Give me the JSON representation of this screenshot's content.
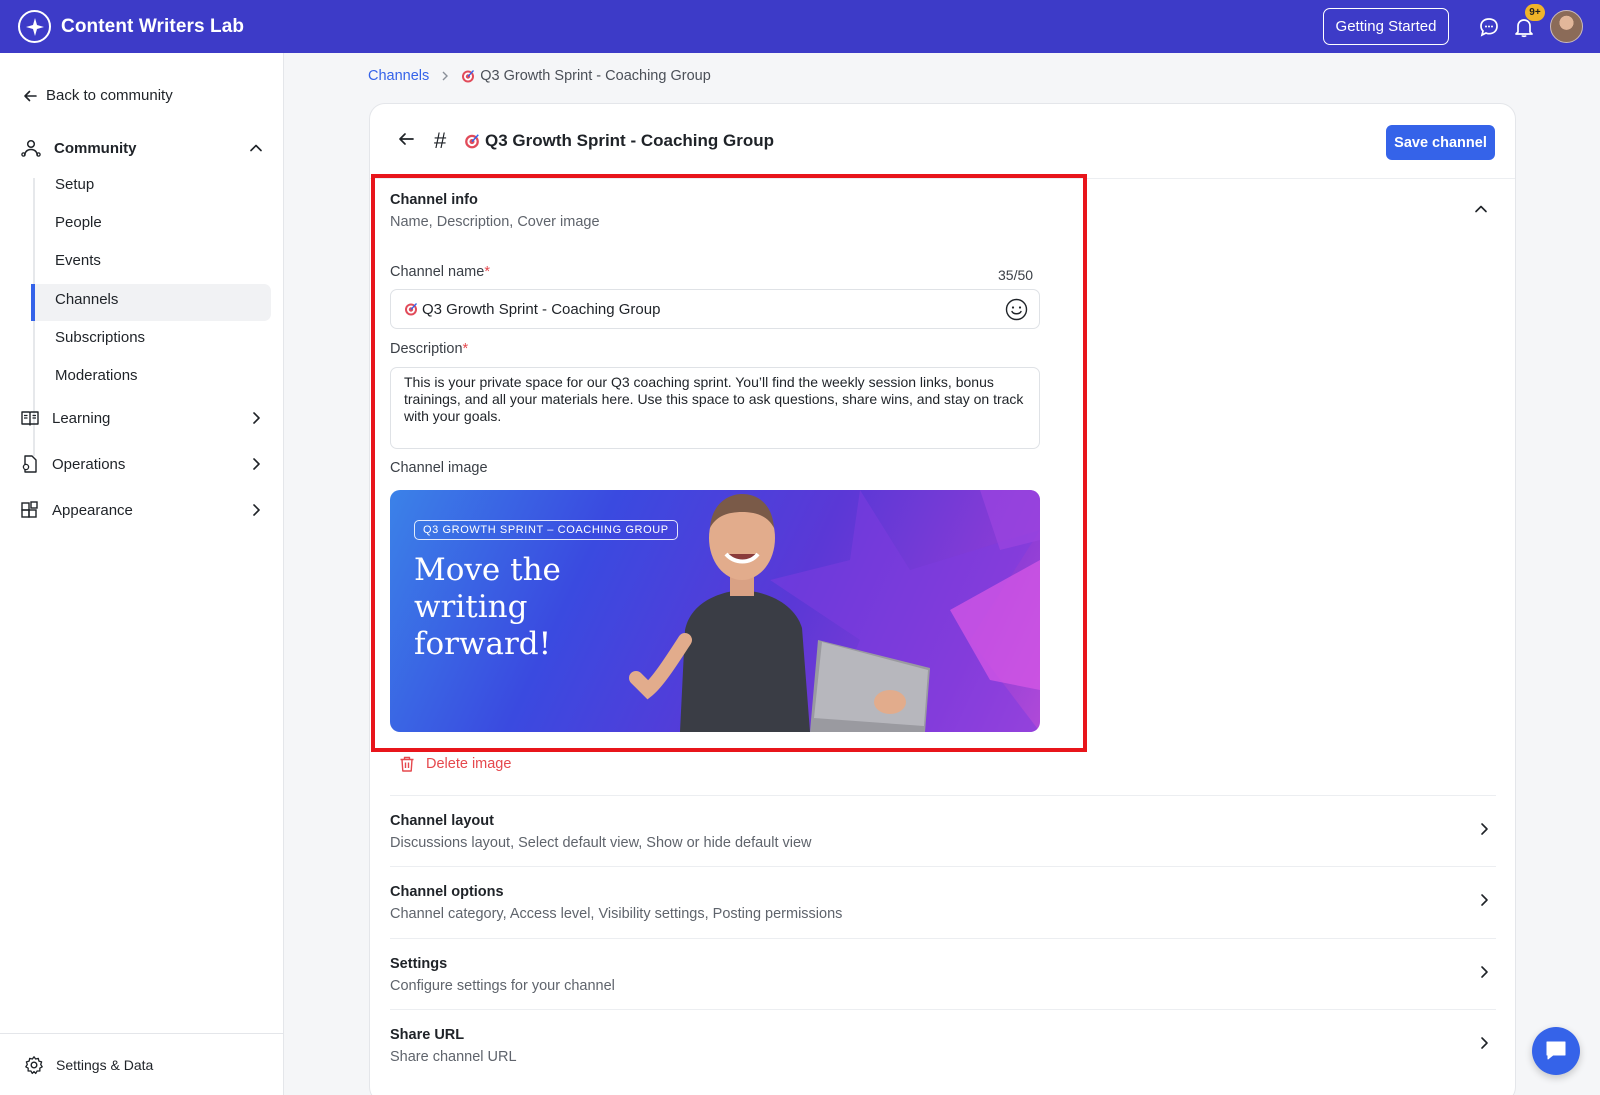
{
  "app": {
    "title": "Content Writers Lab"
  },
  "topbar": {
    "getting_started": "Getting Started",
    "notifications_badge": "9+"
  },
  "sidebar": {
    "back": "Back to community",
    "community": {
      "label": "Community",
      "items": [
        {
          "label": "Setup"
        },
        {
          "label": "People"
        },
        {
          "label": "Events"
        },
        {
          "label": "Channels",
          "active": true
        },
        {
          "label": "Subscriptions"
        },
        {
          "label": "Moderations"
        }
      ]
    },
    "learning": "Learning",
    "operations": "Operations",
    "appearance": "Appearance",
    "settings_data": "Settings & Data"
  },
  "breadcrumb": {
    "parent": "Channels",
    "current": "Q3 Growth Sprint - Coaching Group"
  },
  "channel": {
    "title": "Q3 Growth Sprint - Coaching Group",
    "save_label": "Save channel"
  },
  "channel_info": {
    "title": "Channel info",
    "subtitle": "Name, Description, Cover image",
    "name_label": "Channel name",
    "required_mark": "*",
    "counter": "35/50",
    "name_value": "Q3 Growth Sprint - Coaching Group",
    "description_label": "Description",
    "description_value": "This is your private space for our Q3 coaching sprint. You’ll find the weekly session links, bonus trainings, and all your materials here. Use this space to ask questions, share wins, and stay on track with your goals.",
    "image_label": "Channel image",
    "cover_tag": "Q3 GROWTH SPRINT – COACHING GROUP",
    "cover_headline": "Move the writing forward!",
    "delete_image": "Delete image"
  },
  "sections": [
    {
      "title": "Channel layout",
      "subtitle": "Discussions layout, Select default view, Show or hide default view"
    },
    {
      "title": "Channel options",
      "subtitle": "Channel category, Access level, Visibility settings, Posting permissions"
    },
    {
      "title": "Settings",
      "subtitle": "Configure settings for your channel"
    },
    {
      "title": "Share URL",
      "subtitle": "Share channel URL"
    }
  ],
  "colors": {
    "topbar": "#3d3bc8",
    "accent": "#3563e9",
    "highlight": "#e8151b",
    "danger": "#e5484d"
  }
}
